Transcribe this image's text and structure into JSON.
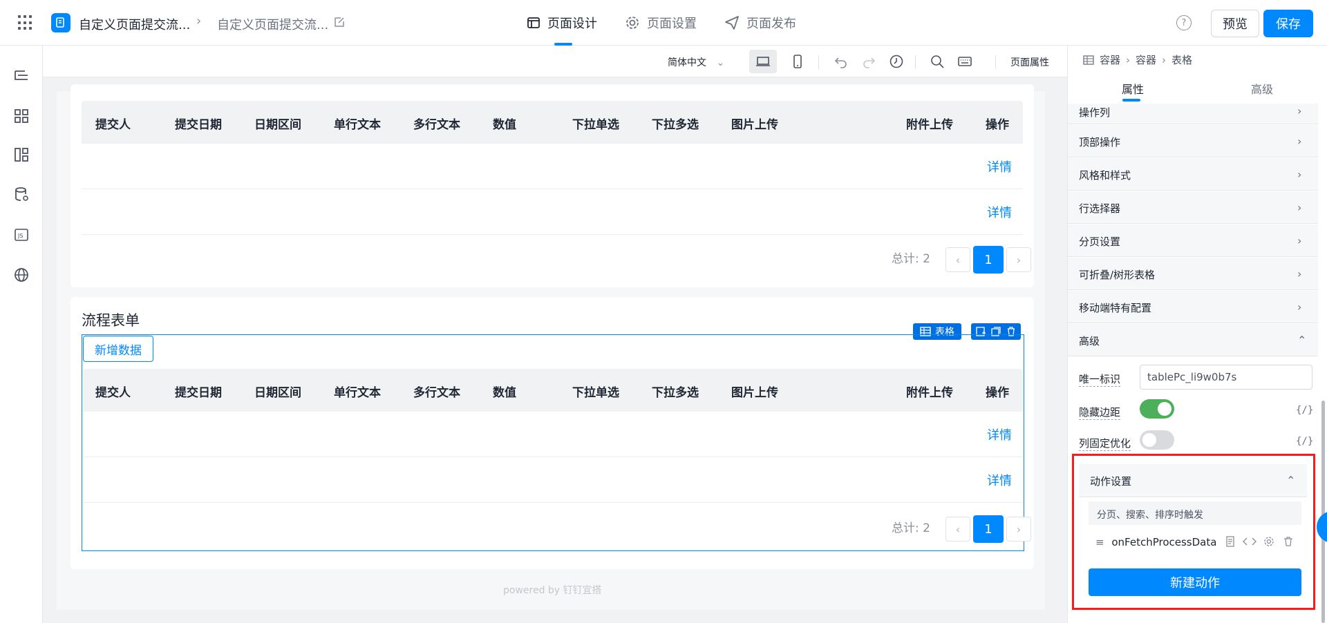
{
  "topbar": {
    "app_name": "自定义页面提交流...",
    "page_name": "自定义页面提交流...",
    "tabs": [
      {
        "label": "页面设计",
        "active": true
      },
      {
        "label": "页面设置",
        "active": false
      },
      {
        "label": "页面发布",
        "active": false
      }
    ],
    "preview_label": "预览",
    "save_label": "保存",
    "help_label": "?"
  },
  "toolbar": {
    "language": "简体中文",
    "page_attr": "页面属性"
  },
  "table1": {
    "columns": [
      "提交人",
      "提交日期",
      "日期区间",
      "单行文本",
      "多行文本",
      "数值",
      "下拉单选",
      "下拉多选",
      "图片上传",
      "附件上传",
      "操作"
    ],
    "rows": [
      {
        "action": "详情"
      },
      {
        "action": "详情"
      }
    ],
    "total": "总计: 2",
    "current_page": "1"
  },
  "flow_form": {
    "title": "流程表单",
    "add_button": "新增数据",
    "tag_label": "表格",
    "columns": [
      "提交人",
      "提交日期",
      "日期区间",
      "单行文本",
      "多行文本",
      "数值",
      "下拉单选",
      "下拉多选",
      "图片上传",
      "附件上传",
      "操作"
    ],
    "rows": [
      {
        "action": "详情"
      },
      {
        "action": "详情"
      }
    ],
    "total": "总计: 2",
    "current_page": "1",
    "powered_by": "powered by 钉钉宜搭"
  },
  "right_panel": {
    "breadcrumb": [
      "容器",
      "容器",
      "表格"
    ],
    "tabs": [
      "属性",
      "高级"
    ],
    "sections": [
      "操作列",
      "顶部操作",
      "风格和样式",
      "行选择器",
      "分页设置",
      "可折叠/树形表格",
      "移动端特有配置",
      "高级"
    ],
    "unique_id_label": "唯一标识",
    "unique_id_value": "tablePc_li9w0b7s",
    "hide_border_label": "隐藏边距",
    "hide_border_on": true,
    "col_fixed_label": "列固定优化",
    "col_fixed_on": false,
    "fx_label": "{/}",
    "action_section": "动作设置",
    "action_trigger": "分页、搜索、排序时触发",
    "action_name": "onFetchProcessData",
    "new_action": "新建动作"
  },
  "colors": {
    "accent": "#0089ff",
    "switch_on": "#4cb05a",
    "highlight": "#ff1a1a"
  }
}
